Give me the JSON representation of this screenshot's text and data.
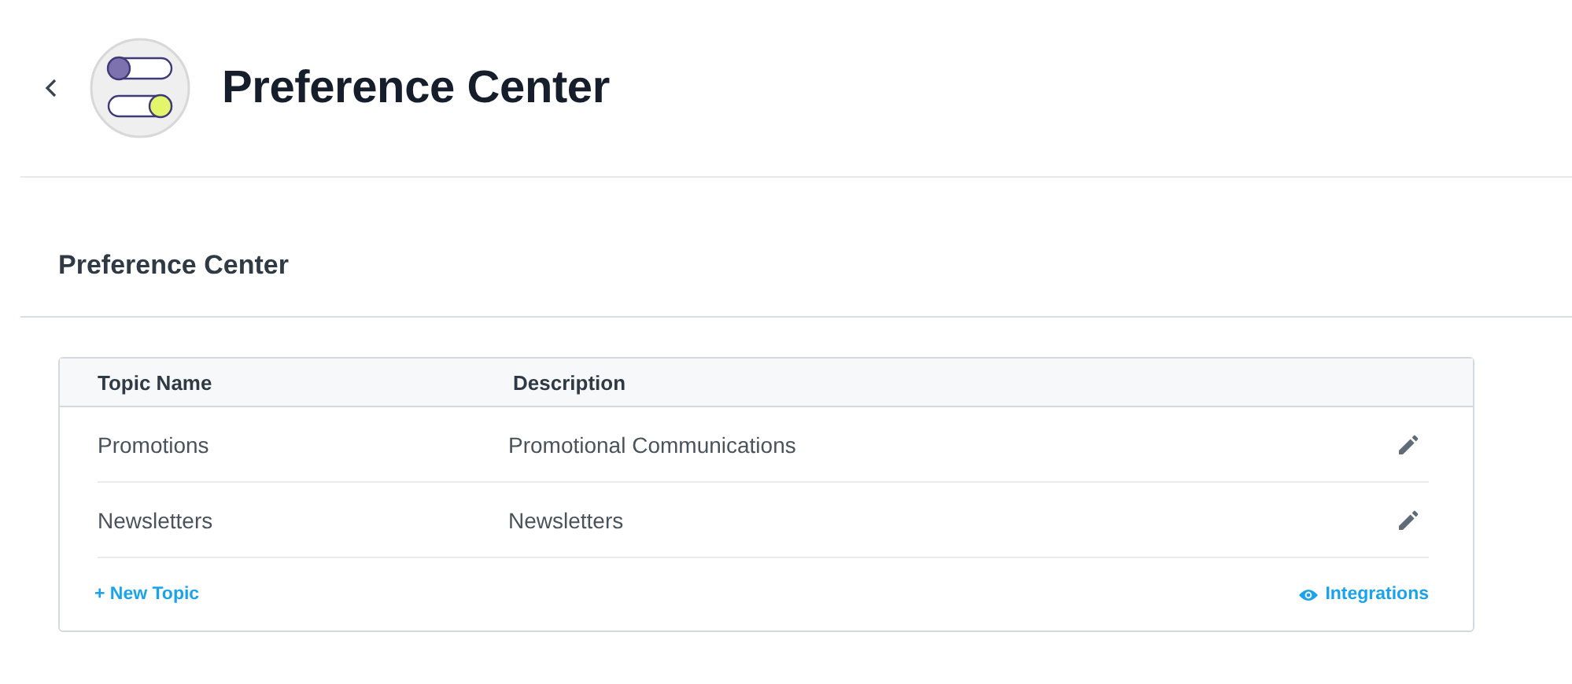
{
  "header": {
    "title": "Preference Center"
  },
  "section": {
    "title": "Preference Center"
  },
  "table": {
    "columns": [
      "Topic Name",
      "Description"
    ],
    "rows": [
      {
        "name": "Promotions",
        "description": "Promotional Communications"
      },
      {
        "name": "Newsletters",
        "description": "Newsletters"
      }
    ],
    "footer": {
      "add_link": "+ New Topic",
      "integrations_link": "Integrations"
    }
  }
}
